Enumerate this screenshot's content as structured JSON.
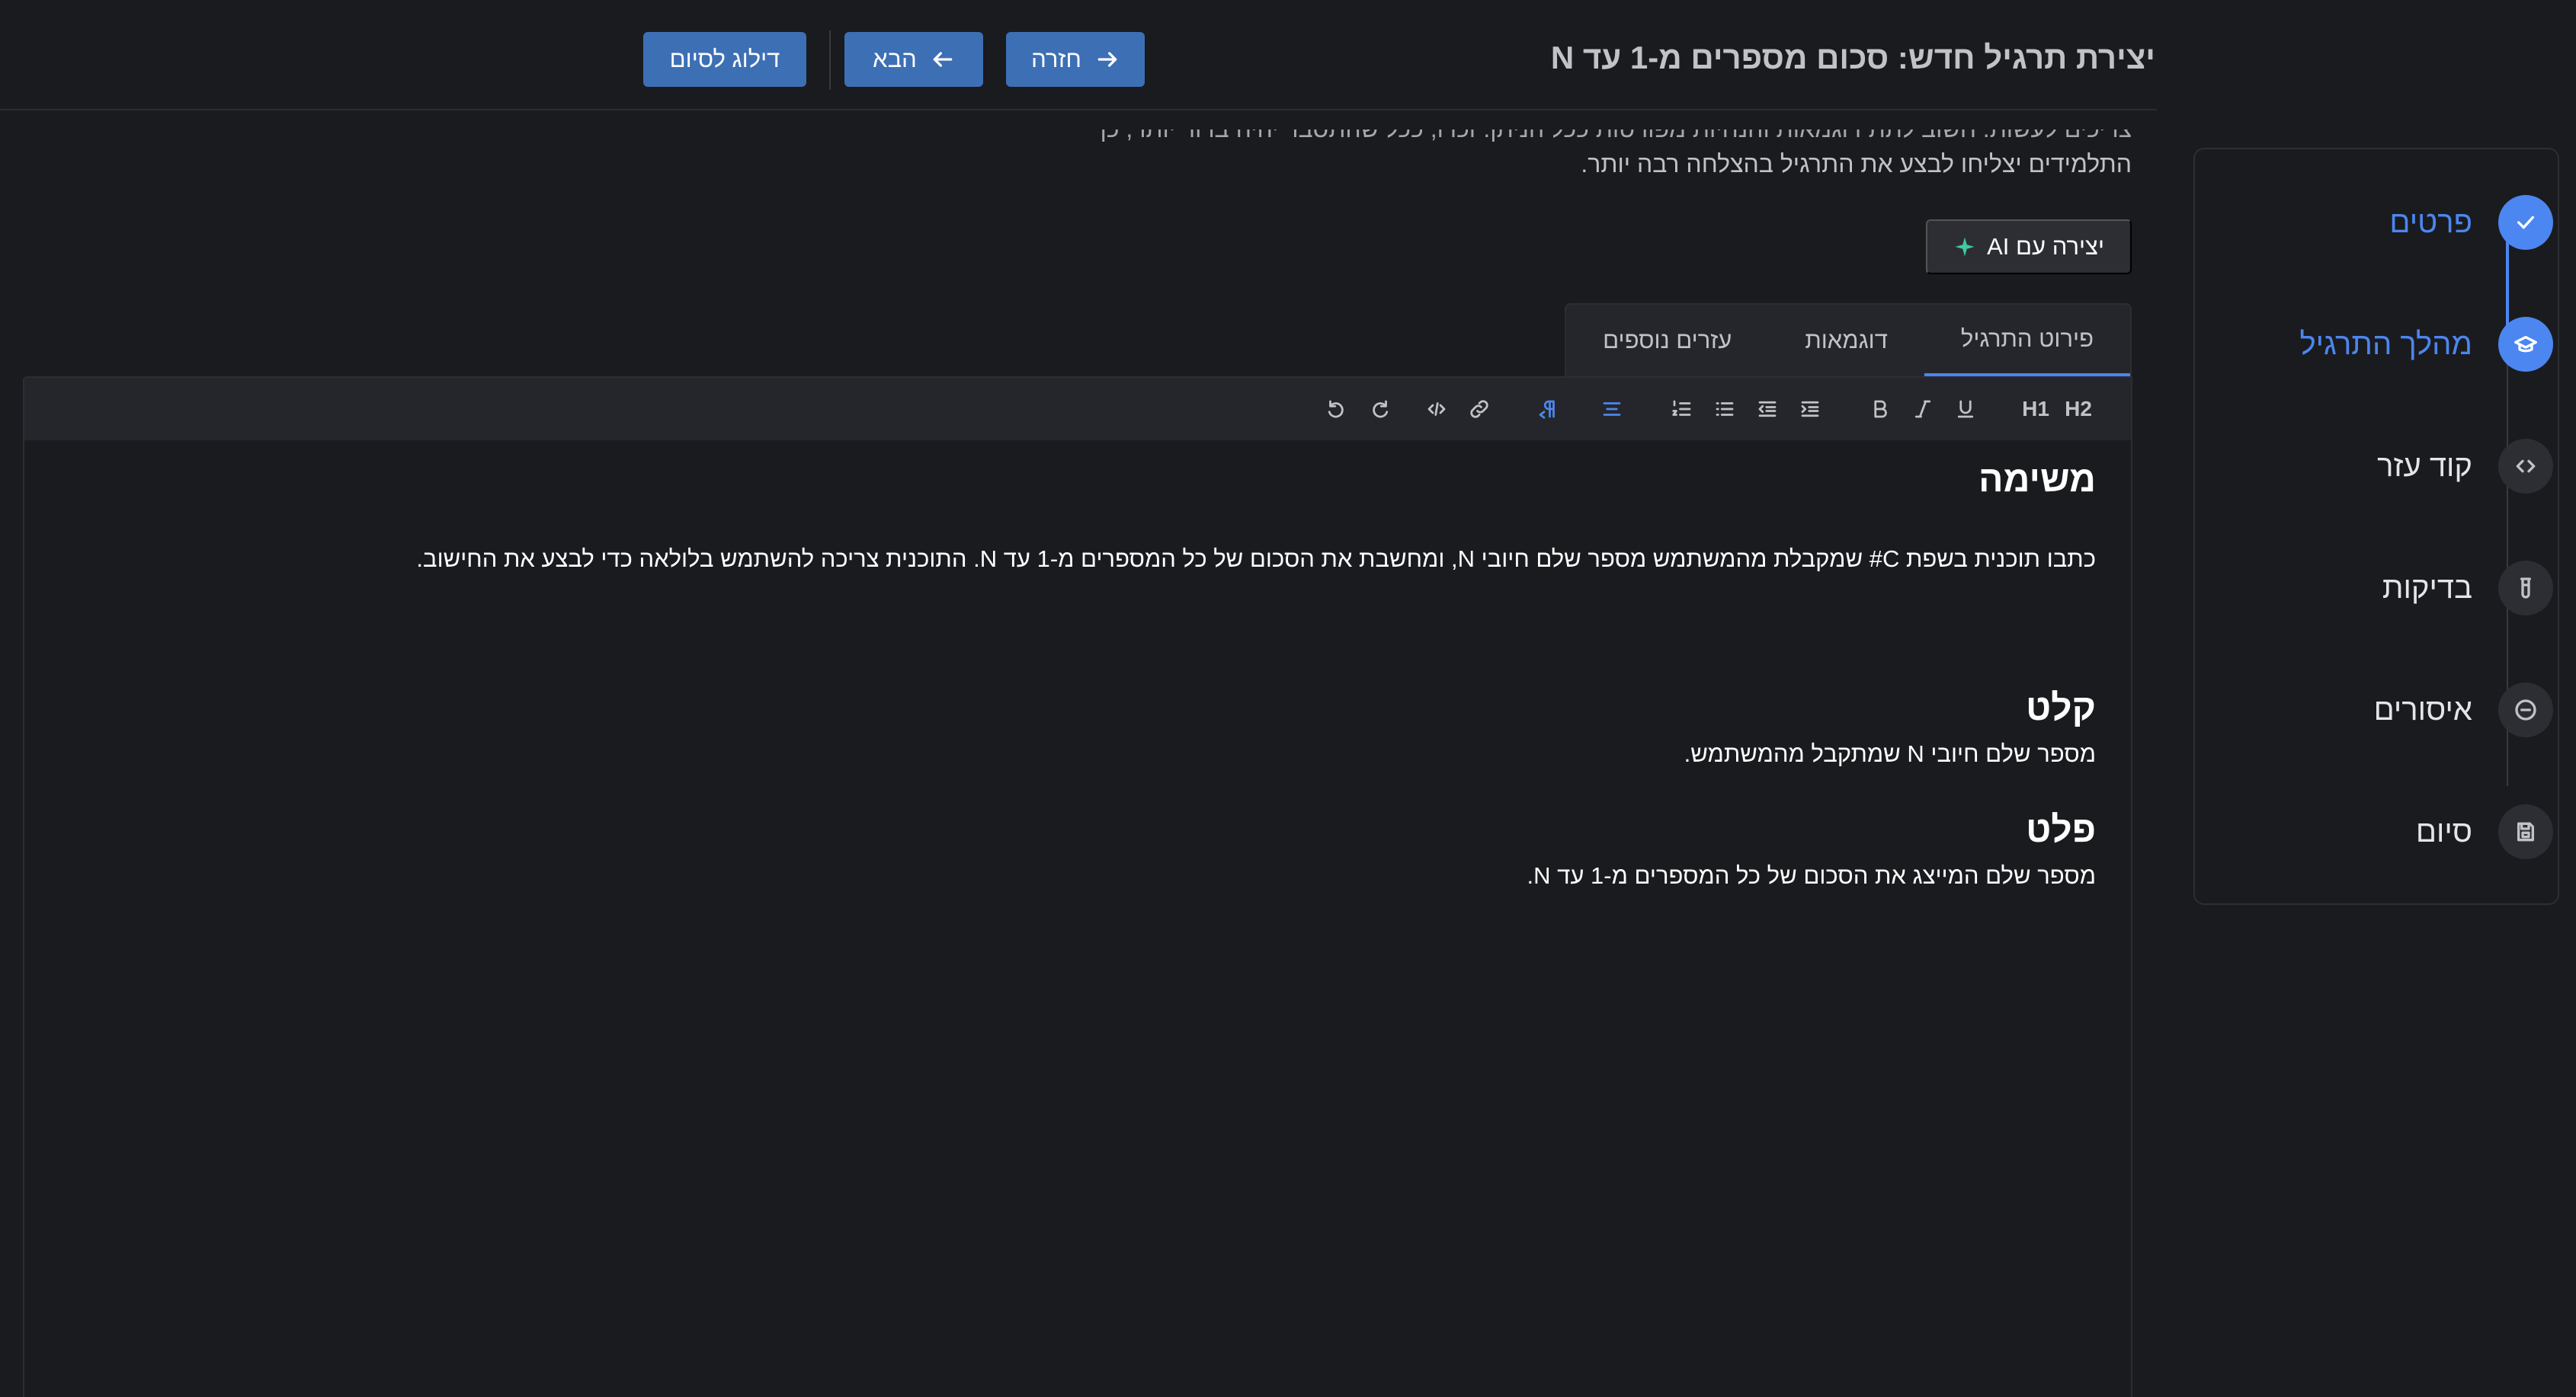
{
  "header": {
    "title": "יצירת תרגיל חדש: סכום מספרים מ-1 עד N",
    "back_label": "חזרה",
    "next_label": "הבא",
    "skip_label": "דילוג לסיום"
  },
  "stepper": {
    "steps": [
      {
        "label": "פרטים",
        "icon": "check-icon",
        "state": "completed"
      },
      {
        "label": "מהלך התרגיל",
        "icon": "graduation-cap-icon",
        "state": "current"
      },
      {
        "label": "קוד עזר",
        "icon": "code-icon",
        "state": "pending"
      },
      {
        "label": "בדיקות",
        "icon": "test-tube-icon",
        "state": "pending"
      },
      {
        "label": "איסורים",
        "icon": "minus-circle-icon",
        "state": "pending"
      },
      {
        "label": "סיום",
        "icon": "save-icon",
        "state": "pending"
      }
    ]
  },
  "intro": {
    "line1": "צריכים לעשות. חשוב לתת דוגמאות והנחיות מפורטות ככל הניתן. זכרו, ככל שהתסבר יהיה ברור יותר, כך",
    "line2": "התלמידים יצליחו לבצע את התרגיל בהצלחה רבה יותר."
  },
  "ai_button": {
    "label": "יצירה עם AI"
  },
  "tabs": [
    {
      "label": "פירוט התרגיל",
      "active": true
    },
    {
      "label": "דוגמאות",
      "active": false
    },
    {
      "label": "עזרים נוספים",
      "active": false
    }
  ],
  "toolbar": {
    "h2": "H2",
    "h1": "H1"
  },
  "editor": {
    "task_heading": "משימה",
    "task_text": "כתבו תוכנית בשפת C# שמקבלת מהמשתמש מספר שלם חיובי N, ומחשבת את הסכום של כל המספרים מ-1 עד N. התוכנית צריכה להשתמש בלולאה כדי לבצע את החישוב.",
    "input_heading": "קלט",
    "input_text": "מספר שלם חיובי N שמתקבל מהמשתמש.",
    "output_heading": "פלט",
    "output_text": "מספר שלם המייצג את הסכום של כל המספרים מ-1 עד N."
  },
  "colors": {
    "accent": "#4c86f0",
    "button": "#3d6fb5",
    "background": "#1a1b1e",
    "ai_sparkle": "#40c9a2"
  }
}
